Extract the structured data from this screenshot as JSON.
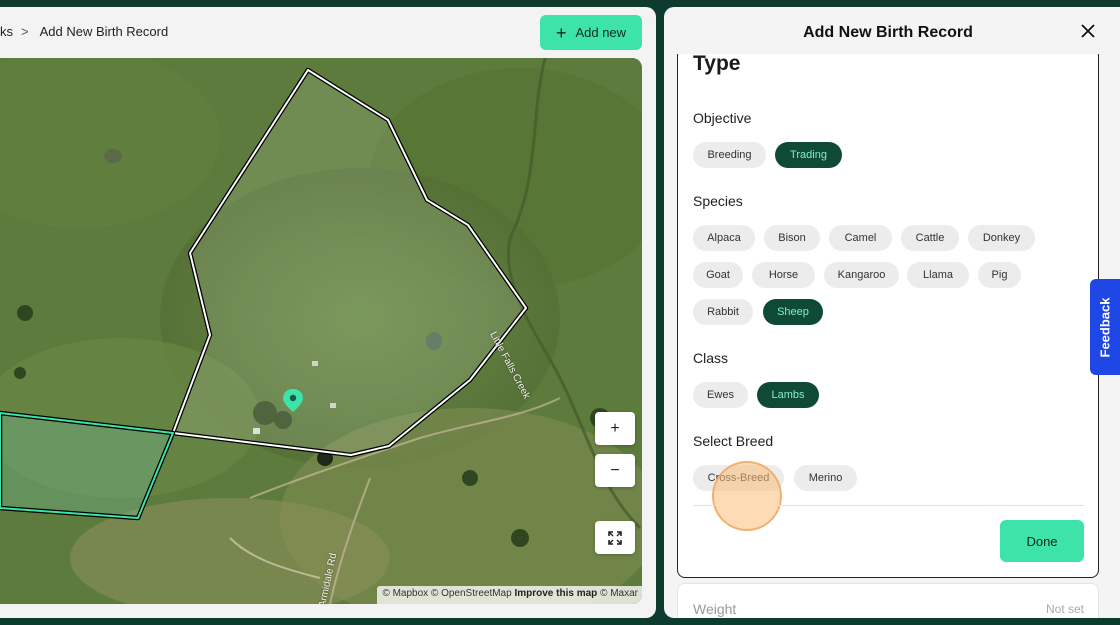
{
  "breadcrumb": {
    "prev": "ks",
    "current": "Add New Birth Record"
  },
  "toolbar": {
    "add_new_label": "Add new"
  },
  "map": {
    "road_labels": {
      "creek": "Little Falls Creek",
      "road": "Armidale Rd"
    },
    "controls": {
      "zoom_in": "+",
      "zoom_out": "−"
    },
    "attribution": {
      "prefix": "© Mapbox © OpenStreetMap",
      "improve": "Improve this map",
      "suffix": "© Maxar"
    }
  },
  "panel": {
    "title": "Add New Birth Record",
    "section_title": "Type",
    "objective": {
      "label": "Objective",
      "options": [
        "Breeding",
        "Trading"
      ],
      "selected": "Trading"
    },
    "species": {
      "label": "Species",
      "options": [
        "Alpaca",
        "Bison",
        "Camel",
        "Cattle",
        "Donkey",
        "Goat",
        "Horse",
        "Kangaroo",
        "Llama",
        "Pig",
        "Rabbit",
        "Sheep"
      ],
      "selected": "Sheep"
    },
    "class": {
      "label": "Class",
      "options": [
        "Ewes",
        "Lambs"
      ],
      "selected": "Lambs"
    },
    "breed": {
      "label": "Select Breed",
      "options": [
        "Cross-Breed",
        "Merino"
      ]
    },
    "done_label": "Done",
    "weight": {
      "label": "Weight",
      "value": "Not set"
    }
  },
  "feedback_label": "Feedback",
  "colors": {
    "accent": "#3de3a8",
    "selected_chip": "#0f4a36",
    "feedback": "#1f47e6",
    "frame": "#0d3b2e"
  }
}
